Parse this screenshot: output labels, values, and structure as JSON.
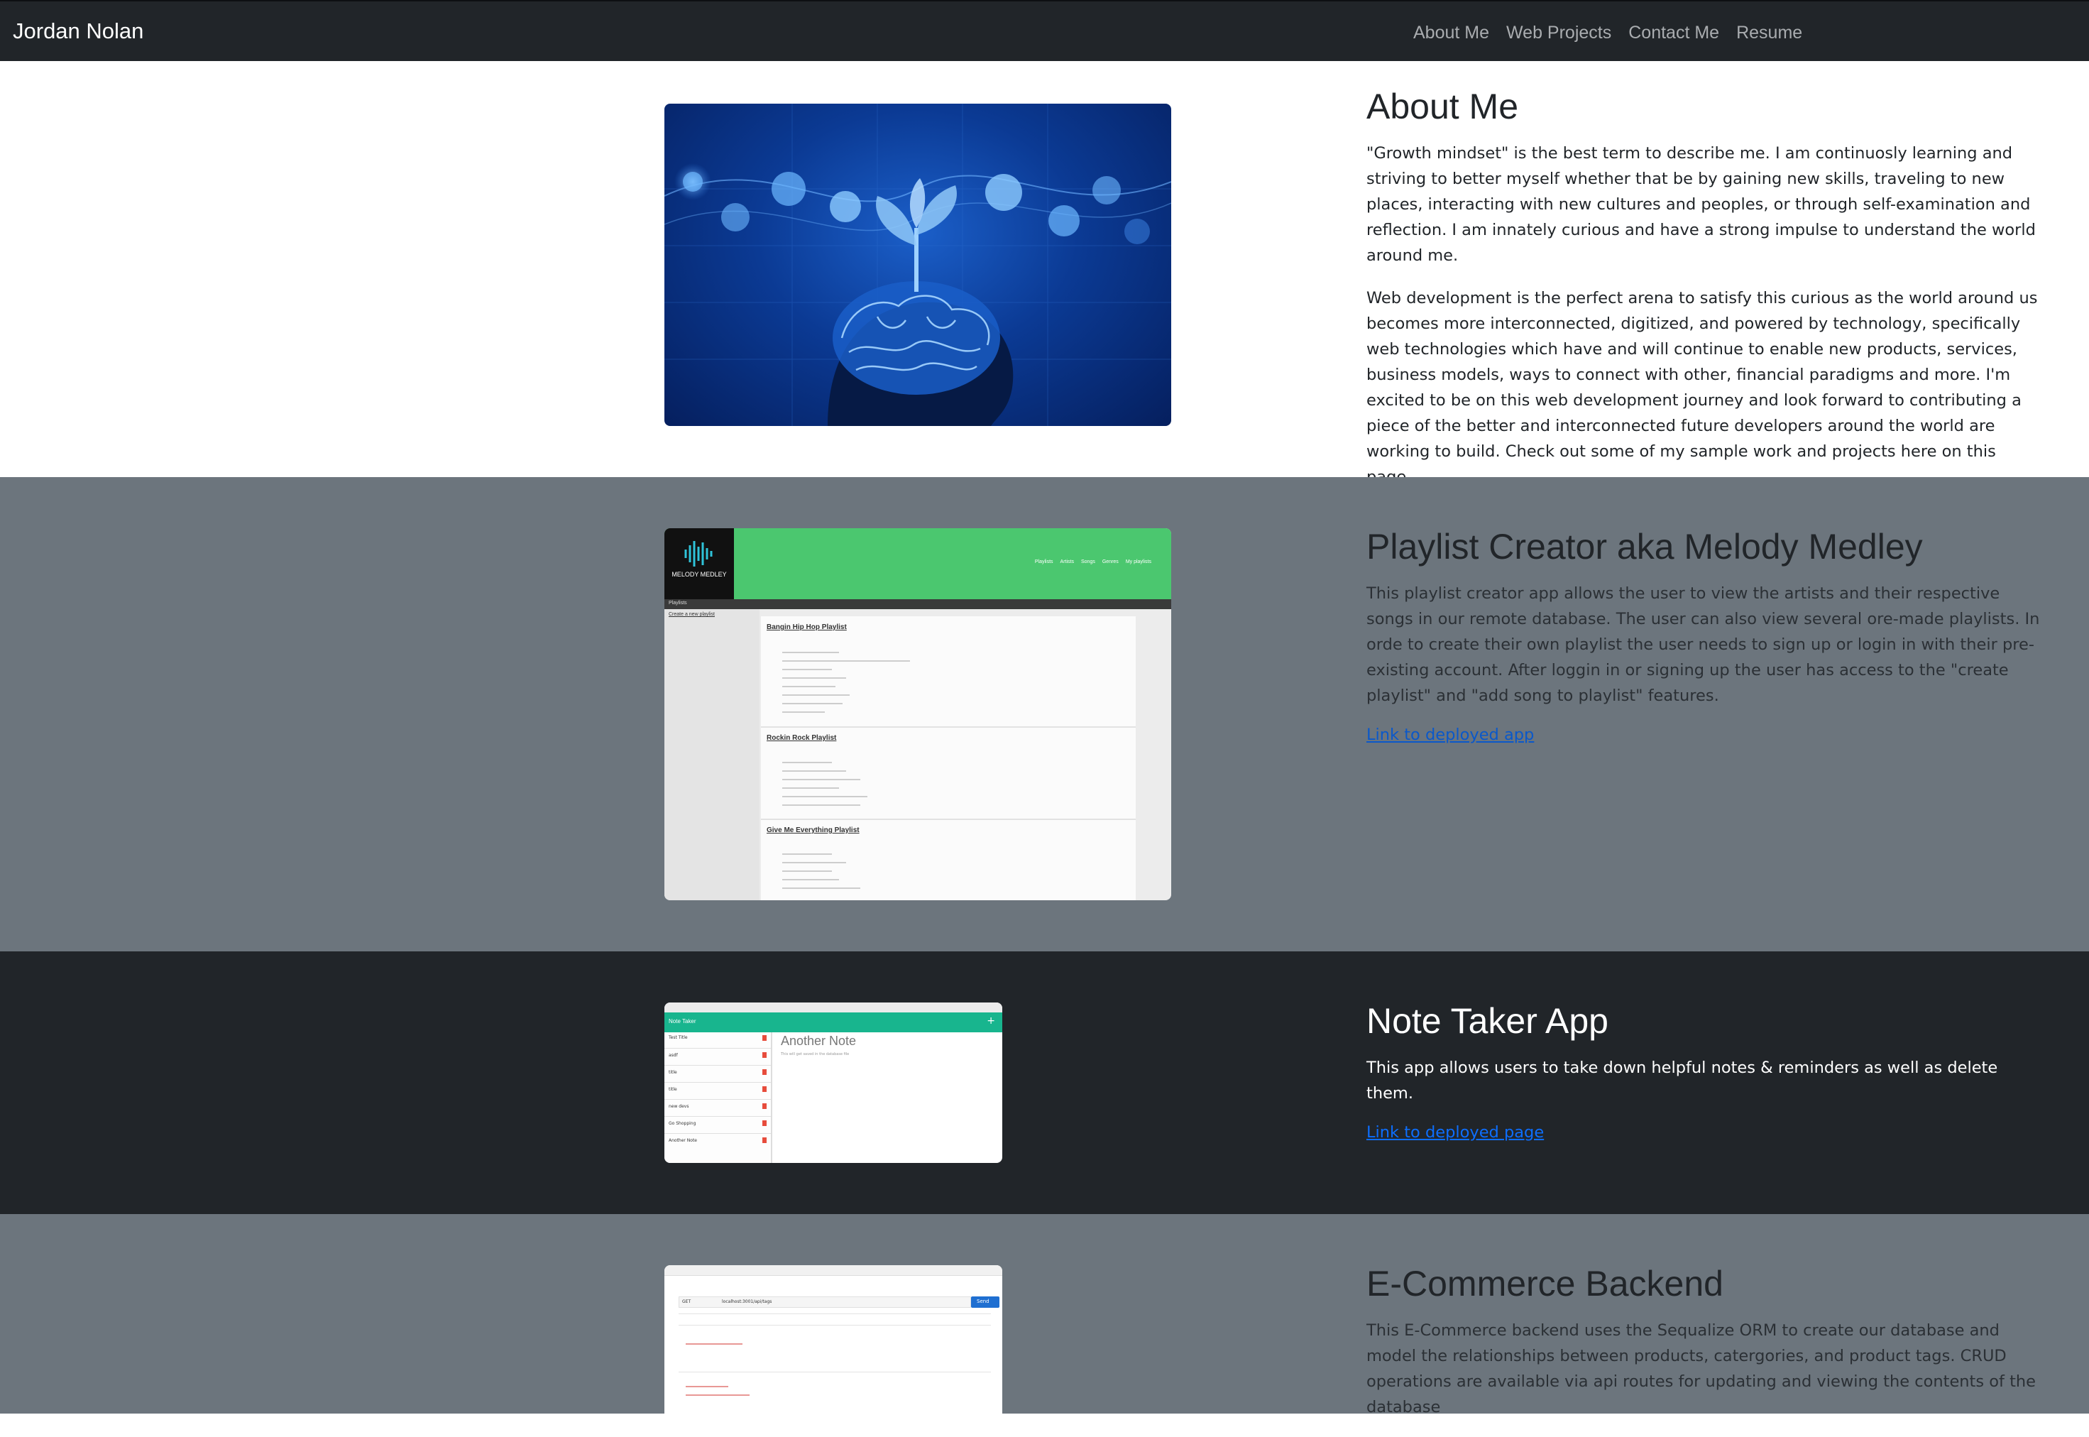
{
  "nav": {
    "brand": "Jordan Nolan",
    "links": [
      "About Me",
      "Web Projects",
      "Contact Me",
      "Resume"
    ]
  },
  "about": {
    "title": "About Me",
    "image_icon": "brain-sprout-illustration",
    "p1": "\"Growth mindset\" is the best term to describe me. I am continuosly learning and striving to better myself whether that be by gaining new skills, traveling to new places, interacting with new cultures and peoples, or through self-examination and reflection. I am innately curious and have a strong impulse to understand the world around me.",
    "p2": "Web development is the perfect arena to satisfy this curious as the world around us becomes more interconnected, digitized, and powered by technology, specifically web technologies which have and will continue to enable new products, services, business models, ways to connect with other, financial paradigms and more. I'm excited to be on this web development journey and look forward to contributing a piece of the better and interconnected future developers around the world are working to build. Check out some of my sample work and projects here on this page."
  },
  "projects": [
    {
      "title": "Playlist Creator aka Melody Medley",
      "desc": "This playlist creator app allows the user to view the artists and their respective songs in our remote database. The user can also view several ore-made playlists. In orde to create their own playlist the user needs to sign up or login in with their pre-existing account. After loggin in or signing up the user has access to the \"create playlist\" and \"add song to playlist\" features.",
      "link": "Link to deployed app",
      "screenshot": {
        "logo_text": "MELODY MEDLEY",
        "nav_items": [
          "Playlists",
          "Artists",
          "Songs",
          "Genres",
          "My playlists"
        ],
        "bar_label": "Playlists",
        "create_link": "Create a new playlist",
        "playlists": [
          "Bangin Hip Hop Playlist",
          "Rockin Rock Playlist",
          "Give Me Everything Playlist"
        ]
      }
    },
    {
      "title": "Note Taker App",
      "desc": "This app allows users to take down helpful notes & reminders as well as delete them.",
      "link": "Link to deployed page",
      "screenshot": {
        "app_title": "Note Taker",
        "note_title": "Another Note",
        "note_body": "This will get saved in the database file",
        "notes": [
          "Test Title",
          "asdf",
          "title",
          "title",
          "new devs",
          "Go Shopping",
          "Another Note"
        ]
      }
    },
    {
      "title": "E-Commerce Backend",
      "desc": "This E-Commerce backend uses the Sequalize ORM to create our database and model the relationships between products, catergories, and product tags. CRUD operations are available via api routes for updating and viewing the contents of the database",
      "screenshot": {
        "url": "localhost:3001/api/tags",
        "method": "GET",
        "send_label": "Send"
      }
    }
  ],
  "colors": {
    "navbar": "#212529",
    "section_gray": "#6c757d",
    "section_dark": "#212529",
    "link": "#0d6efd",
    "melody_green": "#4bc76f",
    "note_teal": "#18b58e"
  }
}
